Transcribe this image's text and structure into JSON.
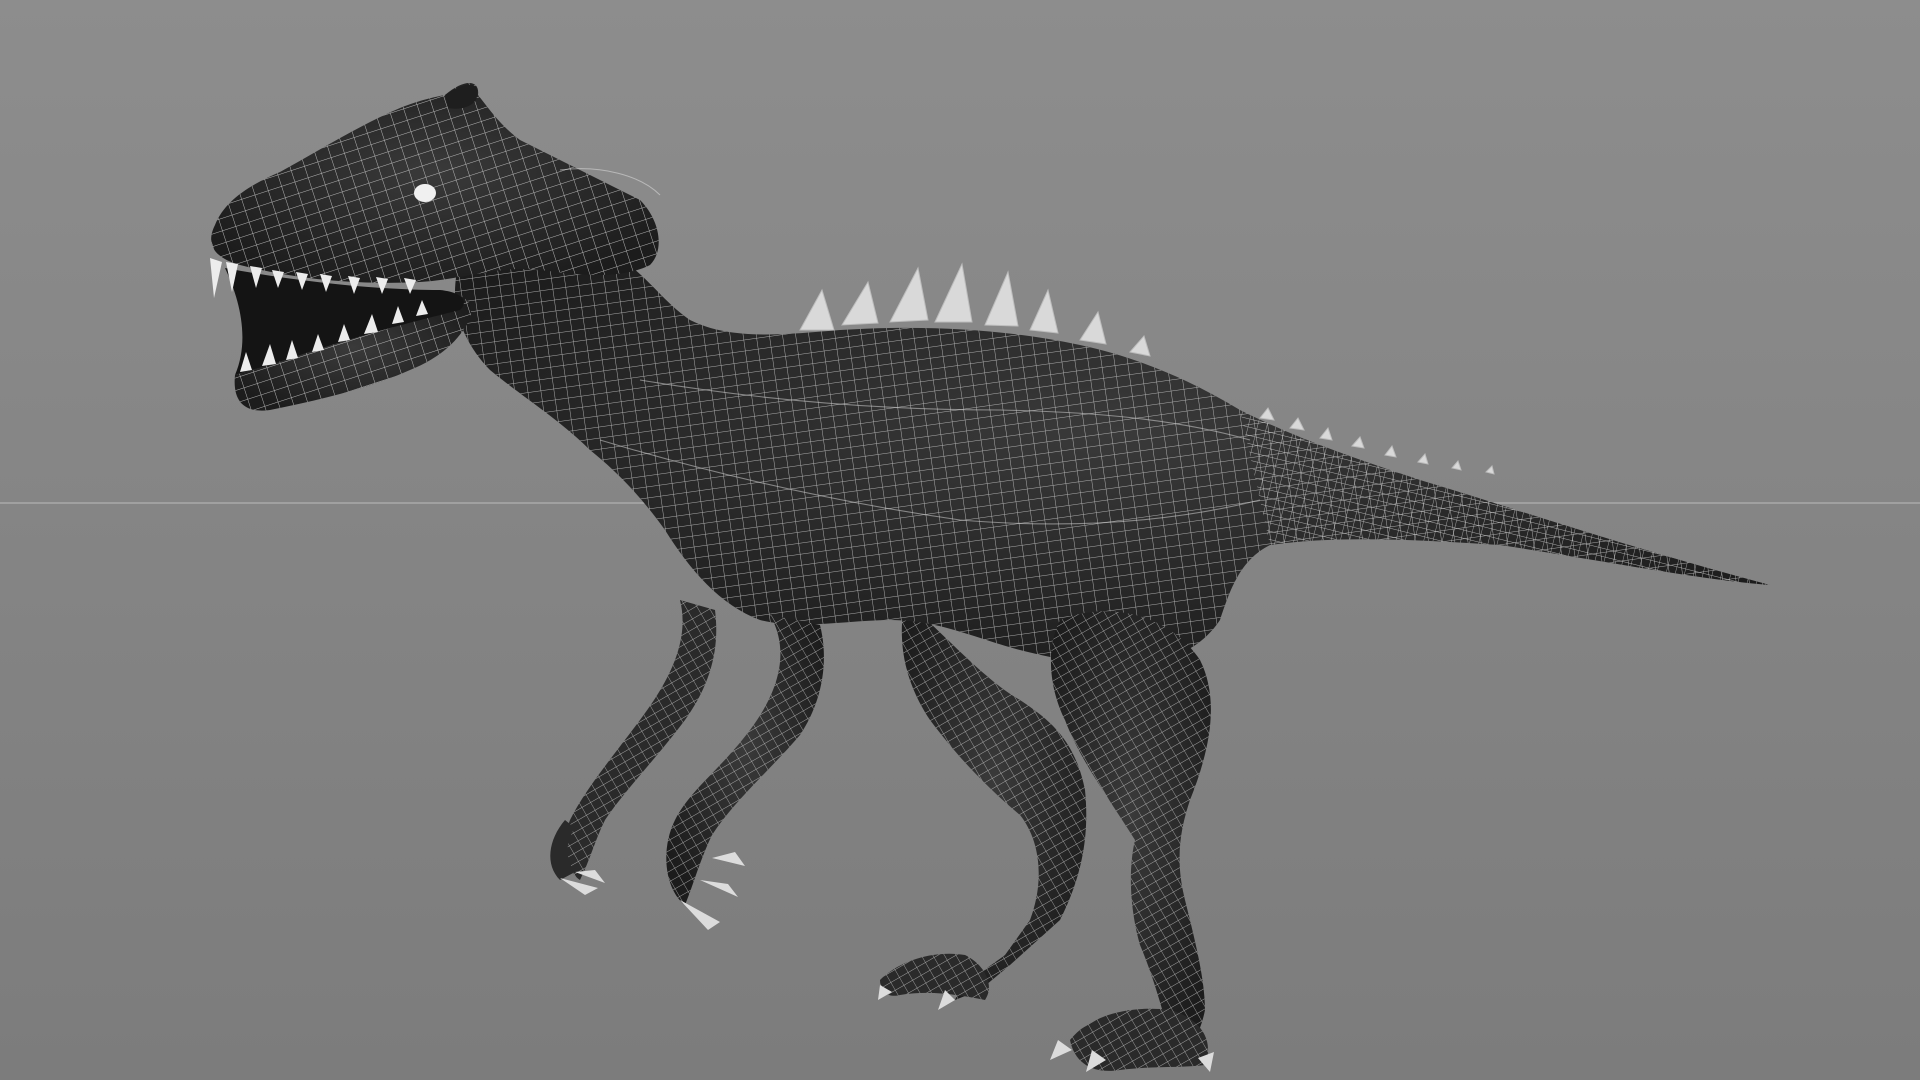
{
  "viewport": {
    "background_top": "#8d8d8d",
    "background_bottom": "#7c7c7c",
    "horizon_line_color": "#b9b9b9",
    "model": {
      "subject": "dinosaur-wireframe-mesh",
      "skin_color": "#2d2d2d",
      "skin_shadow": "#1c1c1c",
      "wire_color": "#d7d7d7",
      "spike_color": "#d9d9d9",
      "tooth_color": "#ececec",
      "eye_color": "#f0f0f0"
    }
  }
}
